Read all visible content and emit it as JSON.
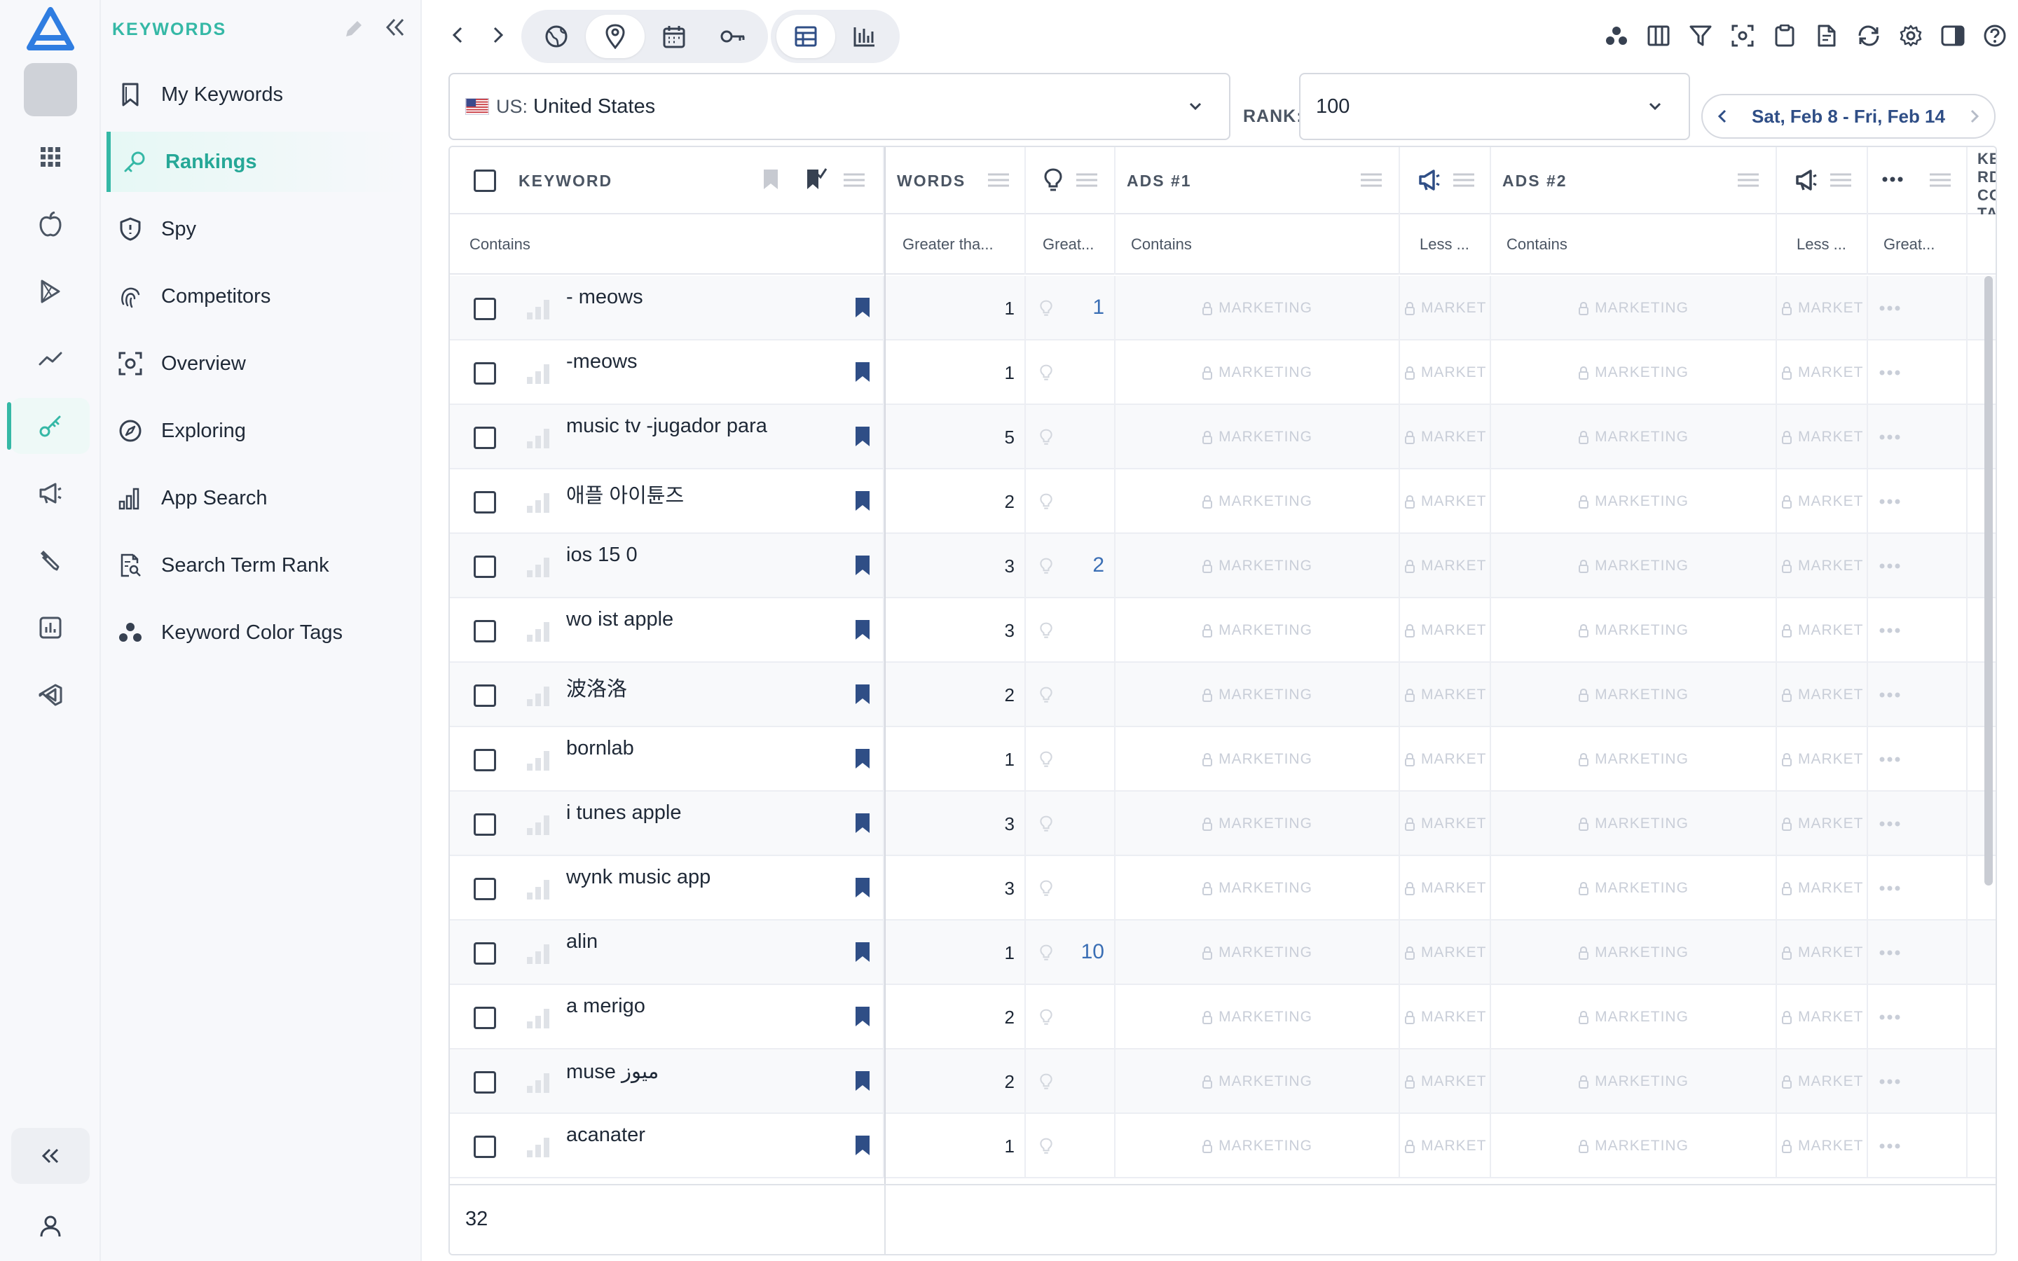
{
  "sidebar": {
    "title": "KEYWORDS",
    "items": [
      {
        "label": "My Keywords",
        "icon": "bookmark-icon"
      },
      {
        "label": "Rankings",
        "icon": "key-icon",
        "active": true
      },
      {
        "label": "Spy",
        "icon": "shield-icon"
      },
      {
        "label": "Competitors",
        "icon": "fingerprint-icon"
      },
      {
        "label": "Overview",
        "icon": "focus-icon"
      },
      {
        "label": "Exploring",
        "icon": "compass-icon"
      },
      {
        "label": "App Search",
        "icon": "bar-chart-icon"
      },
      {
        "label": "Search Term Rank",
        "icon": "document-search-icon"
      },
      {
        "label": "Keyword Color Tags",
        "icon": "color-dots-icon"
      }
    ]
  },
  "filters": {
    "country_code": "US:",
    "country_name": "United States",
    "rank_label": "RANK:",
    "rank_value": "100",
    "date_range": "Sat, Feb 8 - Fri, Feb 14"
  },
  "columns": {
    "keyword": "KEYWORD",
    "words": "WORDS",
    "ads1": "ADS #1",
    "ads2": "ADS #2",
    "cut": "KE RD CO TA"
  },
  "column_filters": {
    "keyword": "Contains",
    "words": "Greater tha...",
    "bulb": "Great...",
    "ads1": "Contains",
    "ads1_icon": "Less ...",
    "ads2": "Contains",
    "ads2_icon": "Less ...",
    "more": "Great..."
  },
  "locked_label": "MARKETING",
  "locked_short": "MARKET",
  "rows": [
    {
      "keyword": "- meows",
      "words": "1",
      "bulb": "1"
    },
    {
      "keyword": "-meows",
      "words": "1",
      "bulb": ""
    },
    {
      "keyword": "music tv -jugador para",
      "words": "5",
      "bulb": ""
    },
    {
      "keyword": "애플 아이튠즈",
      "words": "2",
      "bulb": ""
    },
    {
      "keyword": "ios 15 0",
      "words": "3",
      "bulb": "2"
    },
    {
      "keyword": "wo ist apple",
      "words": "3",
      "bulb": ""
    },
    {
      "keyword": "波洛洛",
      "words": "2",
      "bulb": ""
    },
    {
      "keyword": "bornlab",
      "words": "1",
      "bulb": ""
    },
    {
      "keyword": "i tunes apple",
      "words": "3",
      "bulb": ""
    },
    {
      "keyword": "wynk music app",
      "words": "3",
      "bulb": ""
    },
    {
      "keyword": "alin",
      "words": "1",
      "bulb": "10"
    },
    {
      "keyword": "a merigo",
      "words": "2",
      "bulb": ""
    },
    {
      "keyword": "muse  ميوز",
      "words": "2",
      "bulb": ""
    },
    {
      "keyword": "acanater",
      "words": "1",
      "bulb": ""
    }
  ],
  "footer": {
    "count": "32"
  },
  "colors": {
    "accent": "#35b8a6",
    "bookmark": "#2f4e86",
    "bulb_value": "#3b6fb5"
  }
}
